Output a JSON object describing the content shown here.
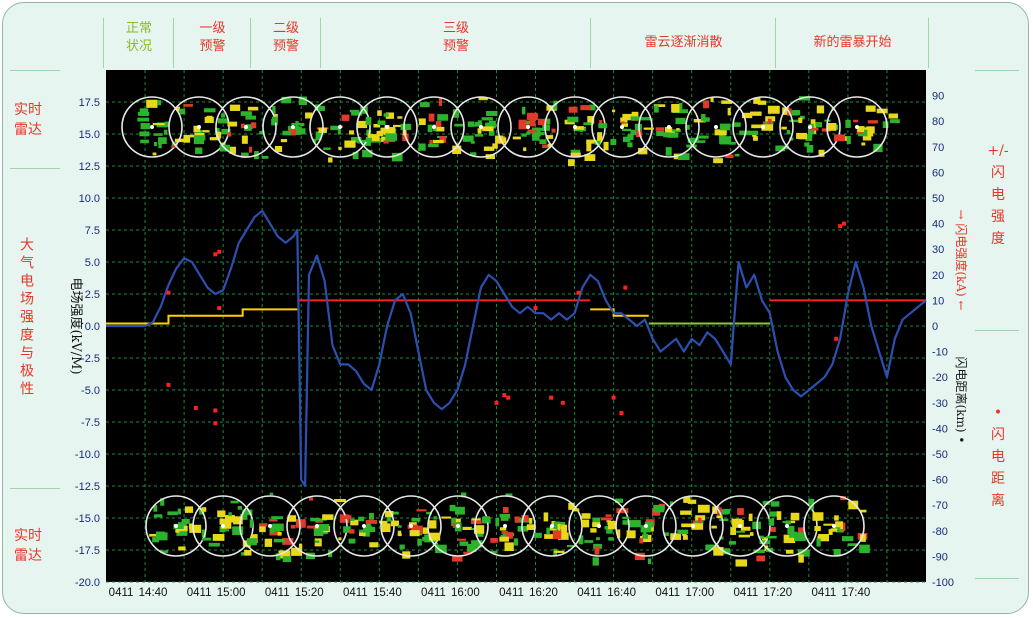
{
  "phases": [
    {
      "label": "正常\n状况",
      "color": "#8cb82e"
    },
    {
      "label": "一级\n预警",
      "color": "#e8362a"
    },
    {
      "label": "二级\n预警",
      "color": "#e8362a"
    },
    {
      "label": "三级\n预警",
      "color": "#e8362a"
    },
    {
      "label": "雷云逐渐消散",
      "color": "#e8362a"
    },
    {
      "label": "新的雷暴开始",
      "color": "#e8362a"
    }
  ],
  "left_labels": {
    "radar_top": "实时\n雷达",
    "field": "大气电场强度与极性",
    "radar_bottom": "实时\n雷达"
  },
  "right_labels": {
    "strength": "+/-\n闪电强度",
    "distance": "• 闪电距离"
  },
  "chart_data": {
    "type": "line",
    "ylabel": "电场强度(kV/M)",
    "y2label_strength": "→ 闪电强度(kA) ←",
    "y2label_distance": "闪电距离(km) •",
    "ylim": [
      -20,
      20
    ],
    "yticks": [
      17.5,
      15.0,
      12.5,
      10.0,
      7.5,
      5.0,
      2.5,
      0.0,
      -2.5,
      -5.0,
      -7.5,
      -10.0,
      -12.5,
      -15.0,
      -17.5,
      -20.0
    ],
    "y2lim": [
      -100,
      100
    ],
    "y2ticks": [
      90,
      80,
      70,
      60,
      50,
      40,
      30,
      20,
      10,
      0,
      -10,
      -20,
      -30,
      -40,
      -50,
      -60,
      -70,
      -80,
      -90,
      -100
    ],
    "xticks": [
      {
        "date": "0411",
        "time": "14:40"
      },
      {
        "date": "0411",
        "time": "15:00"
      },
      {
        "date": "0411",
        "time": "15:20"
      },
      {
        "date": "0411",
        "time": "15:40"
      },
      {
        "date": "0411",
        "time": "16:00"
      },
      {
        "date": "0411",
        "time": "16:20"
      },
      {
        "date": "0411",
        "time": "16:40"
      },
      {
        "date": "0411",
        "time": "17:00"
      },
      {
        "date": "0411",
        "time": "17:20"
      },
      {
        "date": "0411",
        "time": "17:40"
      }
    ],
    "xrange_minutes": [
      14.5,
      18.0
    ],
    "field_series": {
      "color": "#2d4fb0",
      "x": [
        "14:30",
        "14:35",
        "14:40",
        "14:42",
        "14:44",
        "14:46",
        "14:48",
        "14:50",
        "14:52",
        "14:54",
        "14:56",
        "14:58",
        "15:00",
        "15:02",
        "15:04",
        "15:06",
        "15:08",
        "15:10",
        "15:12",
        "15:14",
        "15:16",
        "15:18",
        "15:19",
        "15:20",
        "15:21",
        "15:22",
        "15:24",
        "15:26",
        "15:28",
        "15:30",
        "15:32",
        "15:34",
        "15:36",
        "15:38",
        "15:40",
        "15:42",
        "15:44",
        "15:46",
        "15:48",
        "15:50",
        "15:52",
        "15:54",
        "15:56",
        "15:58",
        "16:00",
        "16:02",
        "16:04",
        "16:06",
        "16:08",
        "16:10",
        "16:12",
        "16:14",
        "16:16",
        "16:18",
        "16:20",
        "16:22",
        "16:24",
        "16:26",
        "16:28",
        "16:30",
        "16:32",
        "16:34",
        "16:36",
        "16:38",
        "16:40",
        "16:42",
        "16:44",
        "16:46",
        "16:48",
        "16:50",
        "16:52",
        "16:54",
        "16:56",
        "16:58",
        "17:00",
        "17:02",
        "17:04",
        "17:06",
        "17:08",
        "17:10",
        "17:12",
        "17:14",
        "17:16",
        "17:18",
        "17:20",
        "17:22",
        "17:24",
        "17:26",
        "17:28",
        "17:30",
        "17:32",
        "17:34",
        "17:36",
        "17:38",
        "17:40",
        "17:42",
        "17:44",
        "17:46",
        "17:48",
        "17:50",
        "17:52",
        "17:54",
        "17:56",
        "17:58",
        "18:00"
      ],
      "y": [
        0.0,
        0.0,
        0.0,
        0.3,
        1.5,
        3.2,
        4.5,
        5.3,
        5.0,
        4.0,
        3.0,
        2.5,
        2.8,
        4.5,
        6.5,
        7.5,
        8.5,
        9.0,
        8.0,
        7.0,
        6.5,
        7.0,
        7.5,
        -12.0,
        -12.5,
        4.0,
        5.5,
        3.5,
        -1.5,
        -3.0,
        -3.0,
        -3.5,
        -4.5,
        -5.0,
        -3.0,
        0.0,
        2.0,
        2.5,
        1.0,
        -2.0,
        -5.0,
        -6.0,
        -6.5,
        -6.0,
        -5.0,
        -3.0,
        0.0,
        3.0,
        4.0,
        3.5,
        2.5,
        1.5,
        1.0,
        1.5,
        1.0,
        1.0,
        0.5,
        1.0,
        0.5,
        1.0,
        3.0,
        4.0,
        3.5,
        2.0,
        1.0,
        1.0,
        0.5,
        0.0,
        0.5,
        -1.0,
        -2.0,
        -1.5,
        -1.0,
        -2.0,
        -1.0,
        -1.5,
        -0.5,
        -1.0,
        -2.0,
        -3.0,
        5.0,
        3.0,
        4.0,
        2.0,
        1.0,
        -2.0,
        -4.0,
        -5.0,
        -5.5,
        -5.0,
        -4.5,
        -4.0,
        -3.0,
        -1.0,
        2.5,
        5.0,
        3.0,
        0.0,
        -2.0,
        -4.0,
        -1.0,
        0.5,
        1.0,
        1.5,
        2.0
      ]
    },
    "level_series": [
      {
        "name": "",
        "color": "#ffd000",
        "x": [
          "14:30",
          "14:46",
          "14:46",
          "15:05",
          "15:05",
          "15:19"
        ],
        "y": [
          0.2,
          0.2,
          0.8,
          0.8,
          1.3,
          1.3
        ]
      },
      {
        "name": "",
        "color": "#ff2020",
        "x": [
          "15:19",
          "16:34"
        ],
        "y": [
          2.0,
          2.0
        ]
      },
      {
        "name": "",
        "color": "#ffd000",
        "x": [
          "16:34",
          "16:40",
          "16:40",
          "16:49"
        ],
        "y": [
          1.3,
          1.3,
          0.8,
          0.8
        ]
      },
      {
        "name": "",
        "color": "#8cc43c",
        "x": [
          "16:49",
          "17:20"
        ],
        "y": [
          0.2,
          0.2
        ]
      },
      {
        "name": "",
        "color": "#ff2020",
        "x": [
          "17:20",
          "18:00"
        ],
        "y": [
          2.0,
          2.0
        ]
      }
    ],
    "distance_points": {
      "color": "#ff2020",
      "x": [
        "14:46",
        "14:46",
        "14:53",
        "14:58",
        "14:58",
        "14:58",
        "14:59",
        "14:59",
        "16:10",
        "16:12",
        "16:13",
        "16:20",
        "16:24",
        "16:27",
        "16:31",
        "16:40",
        "16:42",
        "16:43",
        "17:37",
        "17:38",
        "17:39"
      ],
      "y": [
        13.0,
        -23.0,
        -32.0,
        -33.0,
        -38.0,
        28.0,
        29.0,
        7.0,
        -30.0,
        -27.0,
        -28.0,
        7.0,
        -28.0,
        -30.0,
        13.0,
        -28.0,
        -34.0,
        15.0,
        -5.0,
        39.0,
        40.0
      ]
    }
  }
}
